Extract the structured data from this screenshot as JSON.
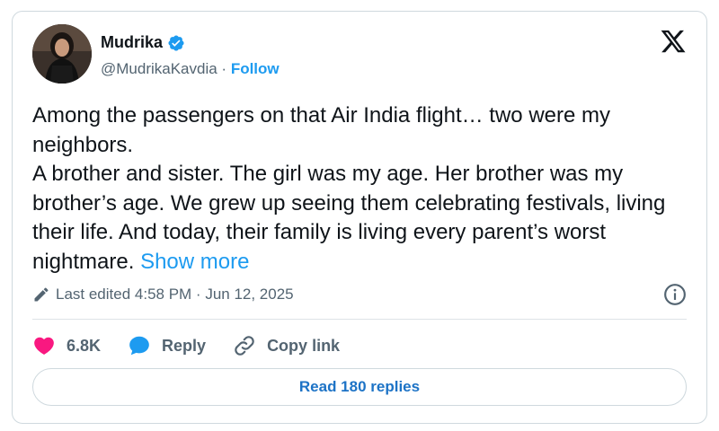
{
  "author": {
    "name": "Mudrika",
    "handle": "@MudrikaKavdia",
    "separator": " · ",
    "follow_label": "Follow"
  },
  "tweet": {
    "text": "Among the passengers on that Air India flight… two were my neighbors.\nA brother and sister. The girl was my age. Her brother was my brother’s age. We grew up seeing them celebrating festivals, living their life. And today, their family is living every parent’s worst nightmare. ",
    "show_more_label": "Show more",
    "edited_label": "Last edited 4:58 PM · Jun 12, 2025"
  },
  "actions": {
    "like_count": "6.8K",
    "reply_label": "Reply",
    "copy_link_label": "Copy link"
  },
  "replies": {
    "read_label": "Read 180 replies"
  },
  "colors": {
    "accent": "#1d9bf0",
    "like": "#f91880",
    "verified": "#1d9bf0"
  },
  "icons": [
    "avatar",
    "verified-badge-icon",
    "x-logo-icon",
    "pencil-icon",
    "info-icon",
    "heart-icon",
    "reply-bubble-icon",
    "link-icon"
  ]
}
